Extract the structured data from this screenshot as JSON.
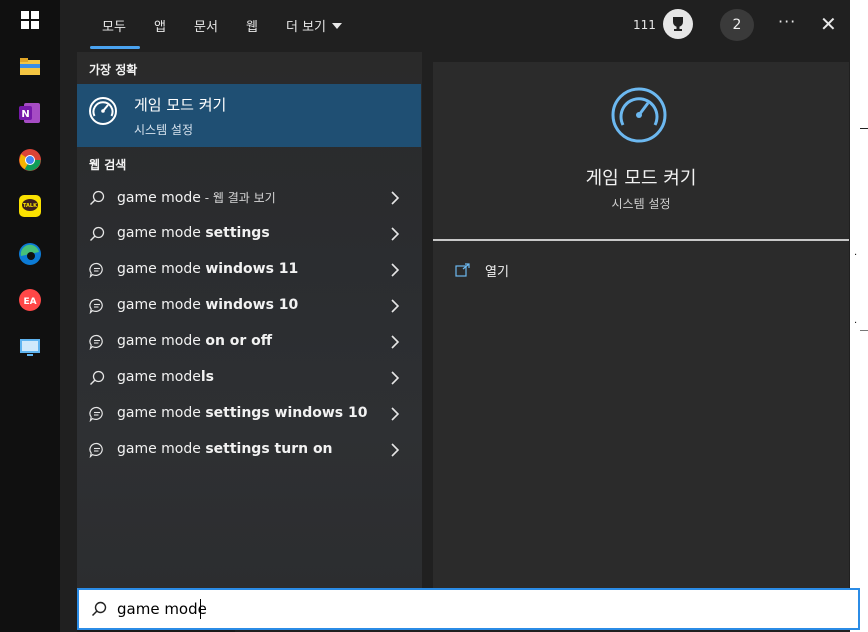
{
  "taskbar": {
    "icons": [
      "windows-start-icon",
      "file-explorer-icon",
      "onenote-icon",
      "chrome-icon",
      "kakaotalk-icon",
      "edge-icon",
      "ea-icon",
      "remote-desktop-icon"
    ],
    "kakaotalk_label": "TALK",
    "onenote_letter": "N",
    "ea_label": "EA"
  },
  "tabs": [
    {
      "label": "모두",
      "active": true
    },
    {
      "label": "앱"
    },
    {
      "label": "문서"
    },
    {
      "label": "웹"
    },
    {
      "label": "더 보기"
    }
  ],
  "header": {
    "points": "111",
    "avatar_label": "2",
    "more_label": "···",
    "close_label": "✕"
  },
  "best_match": {
    "section_label": "가장 정확",
    "title": "게임 모드 켜기",
    "subtitle": "시스템 설정"
  },
  "web_search": {
    "section_label": "웹 검색",
    "items": [
      {
        "icon": "search-icon",
        "normal": "game mode",
        "bold": "",
        "suffix": " - 웹 결과 보기"
      },
      {
        "icon": "search-icon",
        "normal": "game mode ",
        "bold": "settings",
        "suffix": ""
      },
      {
        "icon": "chat-bubble-icon",
        "normal": "game mode ",
        "bold": "windows 11",
        "suffix": ""
      },
      {
        "icon": "chat-bubble-icon",
        "normal": "game mode ",
        "bold": "windows 10",
        "suffix": ""
      },
      {
        "icon": "chat-bubble-icon",
        "normal": "game mode ",
        "bold": "on or off",
        "suffix": ""
      },
      {
        "icon": "search-icon",
        "normal": "game mode",
        "bold": "ls",
        "suffix": ""
      },
      {
        "icon": "chat-bubble-icon",
        "normal": "game mode ",
        "bold": "settings windows 10",
        "suffix": ""
      },
      {
        "icon": "chat-bubble-icon",
        "normal": "game mode ",
        "bold": "settings turn on",
        "suffix": ""
      }
    ]
  },
  "detail": {
    "title": "게임 모드 켜기",
    "subtitle": "시스템 설정",
    "open_label": "열기"
  },
  "search": {
    "value": "game mode"
  },
  "colors": {
    "accent": "#4aa3f0",
    "selection": "#1f4f73",
    "search_border": "#2b8ce6"
  }
}
